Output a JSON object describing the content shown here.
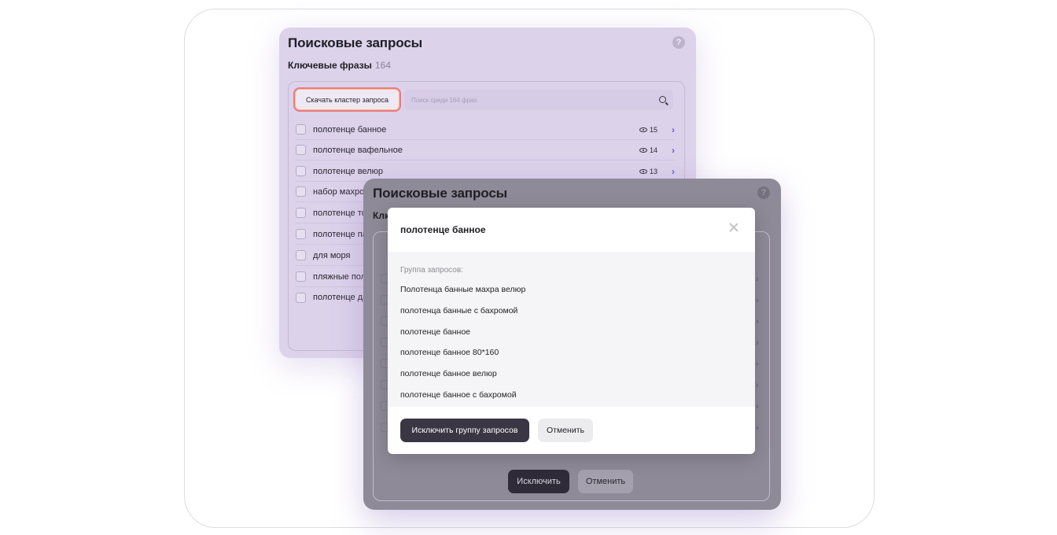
{
  "back_panel": {
    "title": "Поисковые запросы",
    "help_icon": "?",
    "subtitle": "Ключевые фразы",
    "count": "164",
    "download_button": "Скачать кластер запроса",
    "search_placeholder": "Поиск среди 164 фраз",
    "rows": [
      {
        "label": "полотенце банное",
        "views": "15"
      },
      {
        "label": "полотенце вафельное",
        "views": "14"
      },
      {
        "label": "полотенце велюр",
        "views": "13"
      },
      {
        "label": "набор махро",
        "views": ""
      },
      {
        "label": "полотенце то",
        "views": ""
      },
      {
        "label": "полотенце па",
        "views": ""
      },
      {
        "label": "для моря",
        "views": ""
      },
      {
        "label": "пляжные пол",
        "views": ""
      },
      {
        "label": "полотенце да",
        "views": ""
      }
    ]
  },
  "middle_panel": {
    "title": "Поисковые запросы",
    "subtitle_partial": "Клк",
    "help_icon": "?",
    "exclude_button": "Исключить",
    "cancel_button": "Отменить"
  },
  "modal": {
    "title": "полотенце банное",
    "group_label": "Группа запросов:",
    "items": [
      "Полотенца банные махра велюр",
      "полотенца банные с бахромой",
      "полотенце банное",
      "полотенце банное 80*160",
      "полотенце банное велюр",
      "полотенце банное с бахромой"
    ],
    "exclude_group_button": "Исключить группу запросов",
    "cancel_button": "Отменить"
  },
  "colors": {
    "back_panel_bg": "#dcd2ea",
    "overlay_panel_bg": "#8f8a98",
    "primary_button": "#3a3644",
    "highlight_border": "#e8798f"
  }
}
